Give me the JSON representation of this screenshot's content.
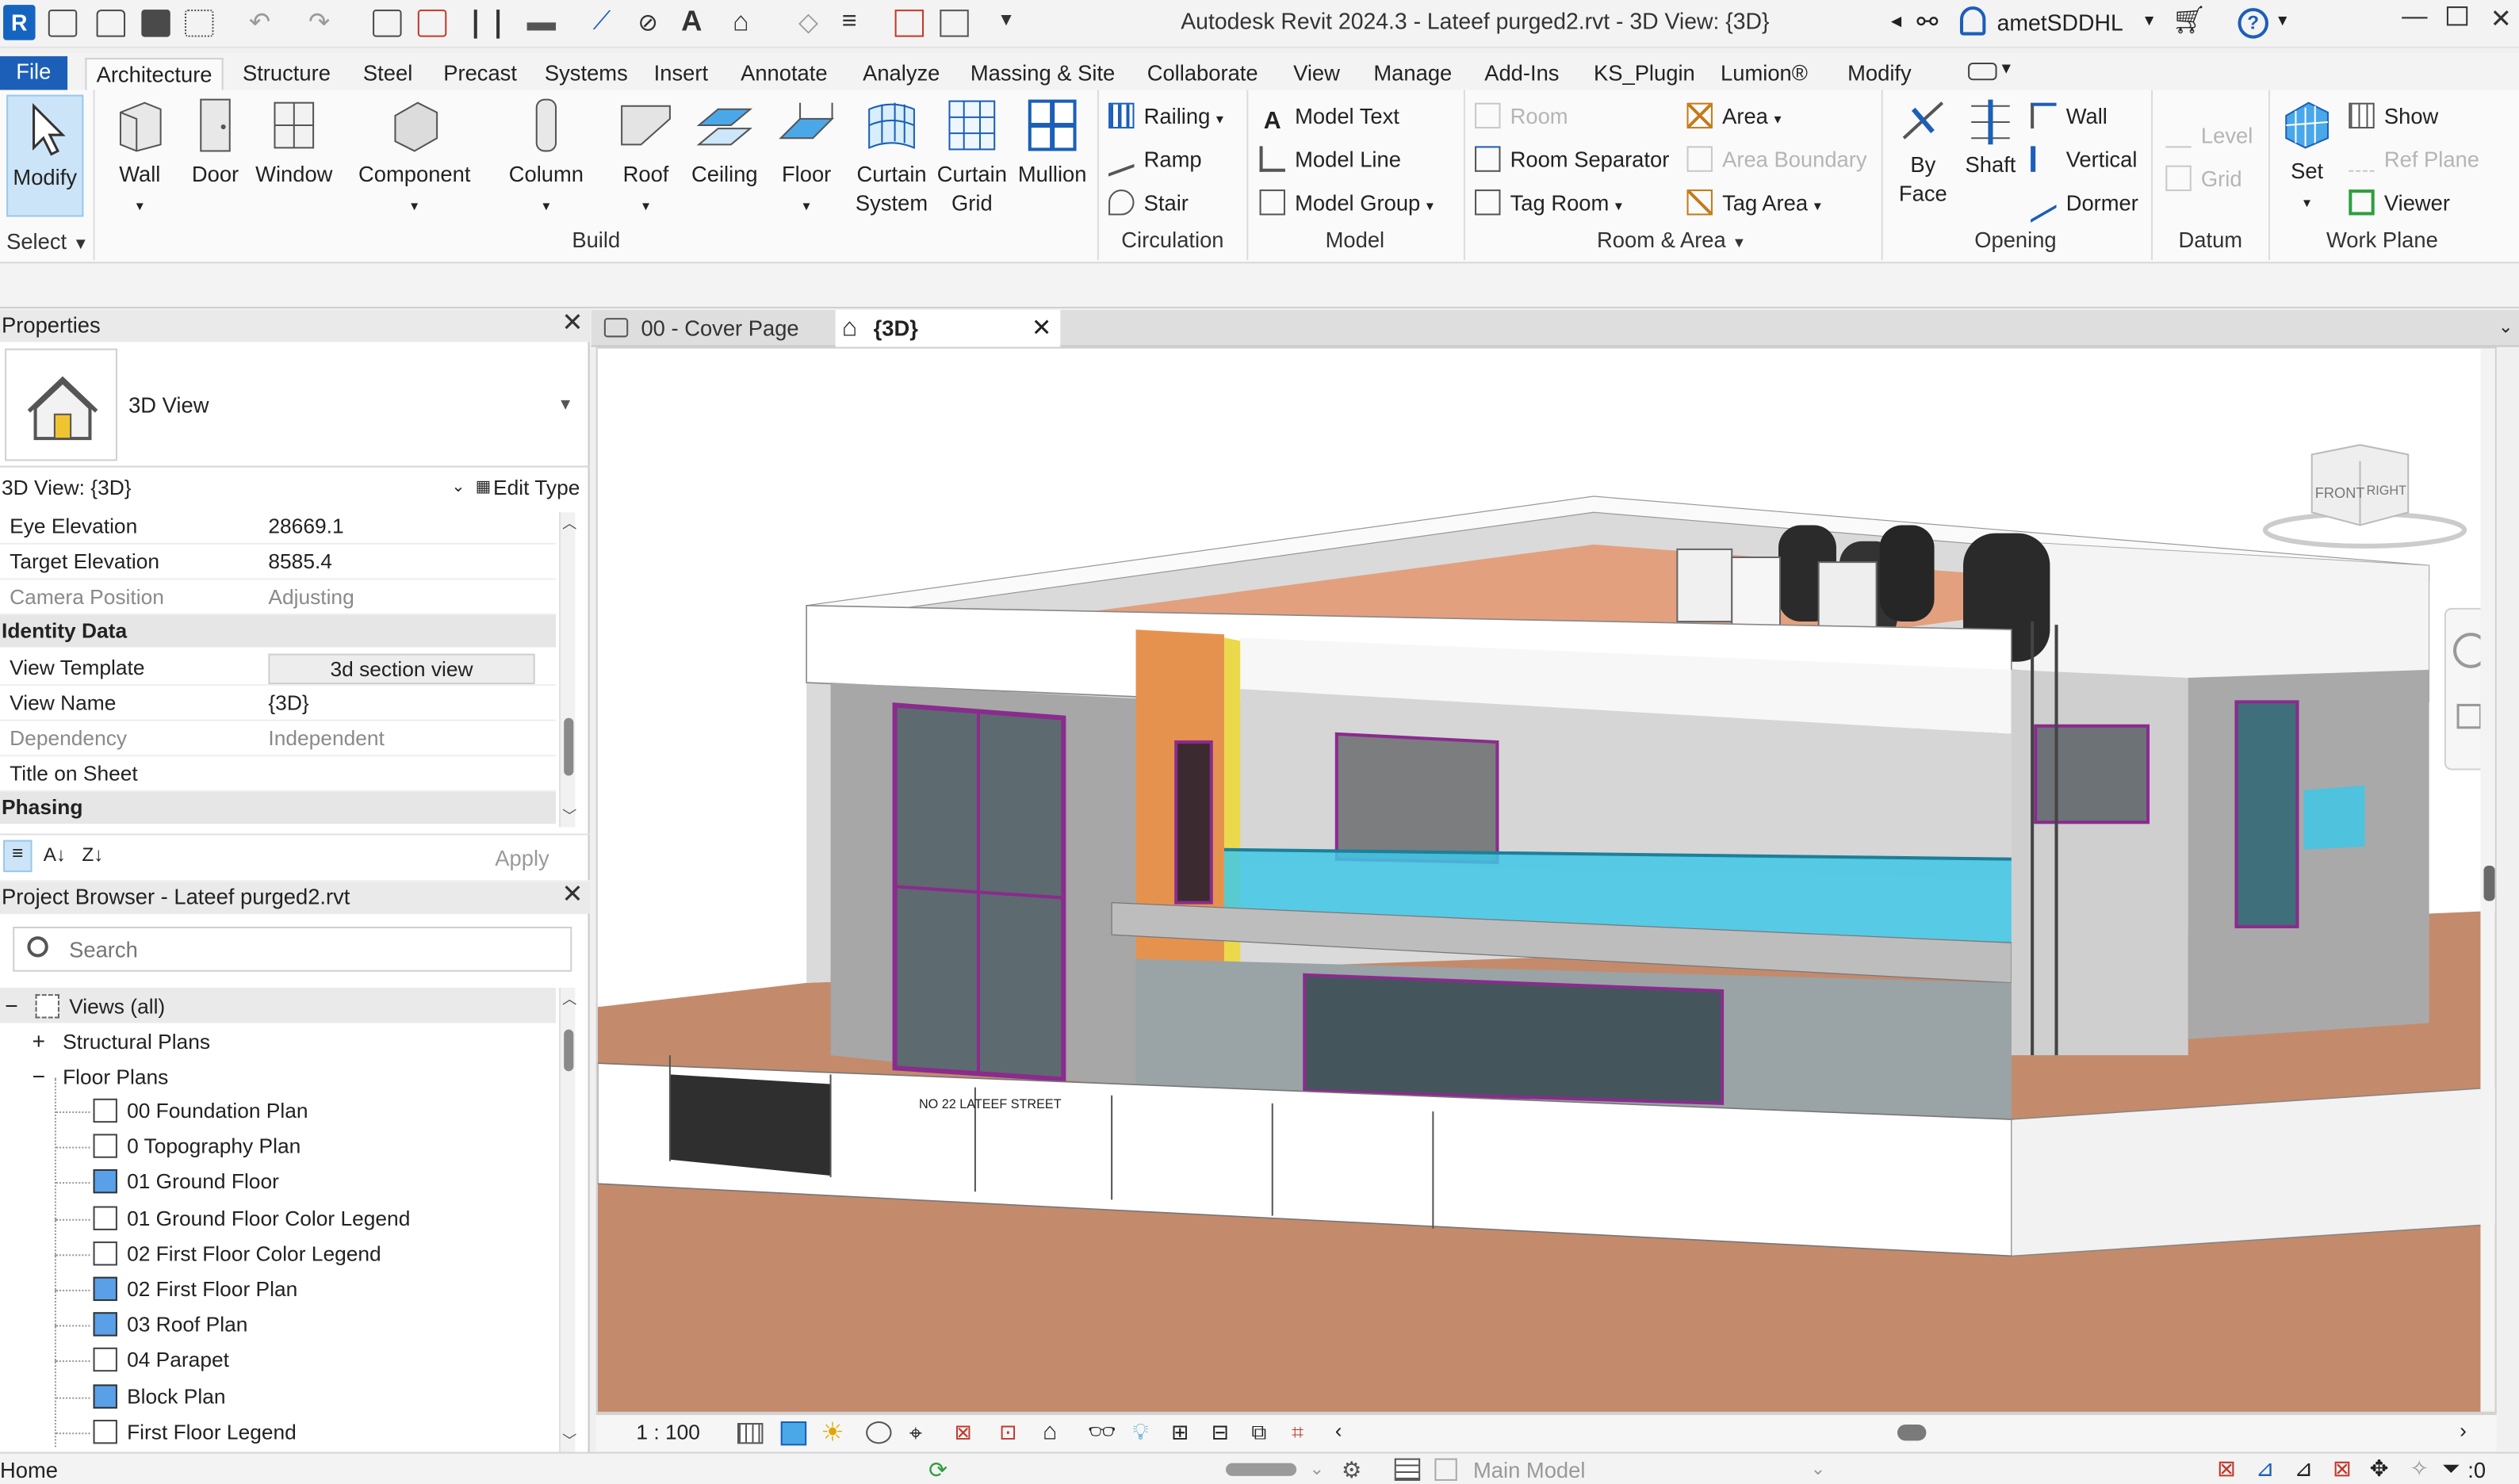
{
  "window": {
    "title": "Autodesk Revit 2024.3 - Lateef purged2.rvt - 3D View: {3D}",
    "user": "ametSDDHL",
    "app_badge": "R"
  },
  "tabs": [
    "File",
    "Architecture",
    "Structure",
    "Steel",
    "Precast",
    "Systems",
    "Insert",
    "Annotate",
    "Analyze",
    "Massing & Site",
    "Collaborate",
    "View",
    "Manage",
    "Add-Ins",
    "KS_Plugin",
    "Lumion®",
    "Modify"
  ],
  "ribbon": {
    "select": {
      "modify": "Modify",
      "panel": "Select"
    },
    "build": {
      "wall": "Wall",
      "door": "Door",
      "window": "Window",
      "component": "Component",
      "column": "Column",
      "roof": "Roof",
      "ceiling": "Ceiling",
      "floor": "Floor",
      "curtain_system_1": "Curtain",
      "curtain_system_2": "System",
      "curtain_grid_1": "Curtain",
      "curtain_grid_2": "Grid",
      "mullion": "Mullion",
      "panel": "Build"
    },
    "circulation": {
      "railing": "Railing",
      "ramp": "Ramp",
      "stair": "Stair",
      "panel": "Circulation"
    },
    "model": {
      "text": "Model  Text",
      "line": "Model  Line",
      "group": "Model  Group",
      "panel": "Model"
    },
    "room_area": {
      "room": "Room",
      "room_separator": "Room  Separator",
      "tag_room": "Tag  Room",
      "area": "Area",
      "area_boundary": "Area  Boundary",
      "tag_area": "Tag  Area",
      "panel": "Room & Area"
    },
    "opening": {
      "by_face_1": "By",
      "by_face_2": "Face",
      "shaft": "Shaft",
      "wall": "Wall",
      "vertical": "Vertical",
      "dormer": "Dormer",
      "panel": "Opening"
    },
    "datum": {
      "level": "Level",
      "grid": "Grid",
      "panel": "Datum"
    },
    "work_plane": {
      "set": "Set",
      "show": "Show",
      "ref_plane": "Ref  Plane",
      "viewer": "Viewer",
      "panel": "Work Plane"
    }
  },
  "properties": {
    "title": "Properties",
    "type_name": "3D View",
    "selector": "3D View: {3D}",
    "edit_type": "Edit Type",
    "rows_camera": [
      {
        "key": "Eye Elevation",
        "value": "28669.1"
      },
      {
        "key": "Target Elevation",
        "value": "8585.4"
      },
      {
        "key": "Camera Position",
        "value": "Adjusting"
      }
    ],
    "group_identity": "Identity Data",
    "rows_identity": [
      {
        "key": "View Template",
        "value": "3d section view"
      },
      {
        "key": "View Name",
        "value": "{3D}"
      },
      {
        "key": "Dependency",
        "value": "Independent"
      },
      {
        "key": "Title on Sheet",
        "value": ""
      }
    ],
    "group_phasing": "Phasing",
    "apply": "Apply"
  },
  "browser": {
    "title": "Project Browser - Lateef purged2.rvt",
    "search_placeholder": "Search",
    "root": "Views (all)",
    "structural": "Structural Plans",
    "floor_plans": "Floor Plans",
    "items": [
      {
        "label": "00 Foundation Plan",
        "blue": false
      },
      {
        "label": "0 Topography Plan",
        "blue": false
      },
      {
        "label": "01 Ground Floor",
        "blue": true
      },
      {
        "label": "01 Ground Floor Color Legend",
        "blue": false
      },
      {
        "label": "02 First Floor Color Legend",
        "blue": false
      },
      {
        "label": "02 First Floor Plan",
        "blue": true
      },
      {
        "label": "03 Roof Plan",
        "blue": true
      },
      {
        "label": "04 Parapet",
        "blue": false
      },
      {
        "label": "Block Plan",
        "blue": true
      },
      {
        "label": "First Floor Legend",
        "blue": false
      }
    ]
  },
  "view_tabs": [
    {
      "label": "00 - Cover Page",
      "active": false
    },
    {
      "label": "{3D}",
      "active": true
    }
  ],
  "viewcube": {
    "front": "FRONT",
    "right": "RIGHT"
  },
  "scene": {
    "street_sign": "NO 22 LATEEF STREET"
  },
  "view_control_bar": {
    "scale": "1 : 100"
  },
  "status": {
    "left": "Home",
    "model": "Main Model",
    "filter_count": ":0"
  },
  "colors": {
    "accent": "#1b5fb8",
    "roof_terracotta": "#e3a07f",
    "ground": "#c48a6c",
    "glass": "#3fc7e6"
  }
}
